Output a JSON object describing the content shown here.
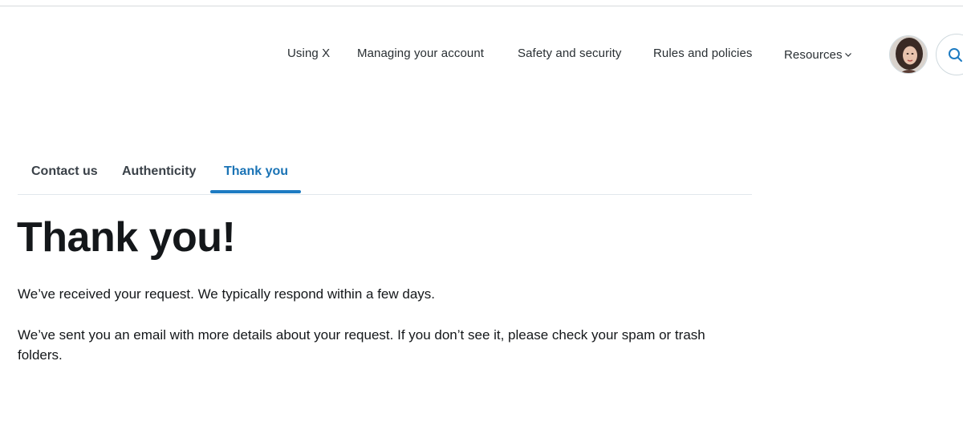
{
  "nav": {
    "items": [
      {
        "label": "Using X"
      },
      {
        "label": "Managing your account"
      },
      {
        "label": "Safety and security"
      },
      {
        "label": "Rules and policies"
      },
      {
        "label": "Resources"
      }
    ],
    "resources_chevron": "chevron-down-icon",
    "search_icon": "search-icon",
    "avatar": "user-avatar"
  },
  "tabs": [
    {
      "label": "Contact us",
      "active": false
    },
    {
      "label": "Authenticity",
      "active": false
    },
    {
      "label": "Thank you",
      "active": true
    }
  ],
  "main": {
    "title": "Thank you!",
    "paragraphs": [
      "We’ve received your request. We typically respond within a few days.",
      "We’ve sent you an email with more details about your request. If you don’t see it, please check your spam or trash folders."
    ]
  },
  "colors": {
    "accent": "#1d7bc2",
    "text": "#14171a"
  }
}
